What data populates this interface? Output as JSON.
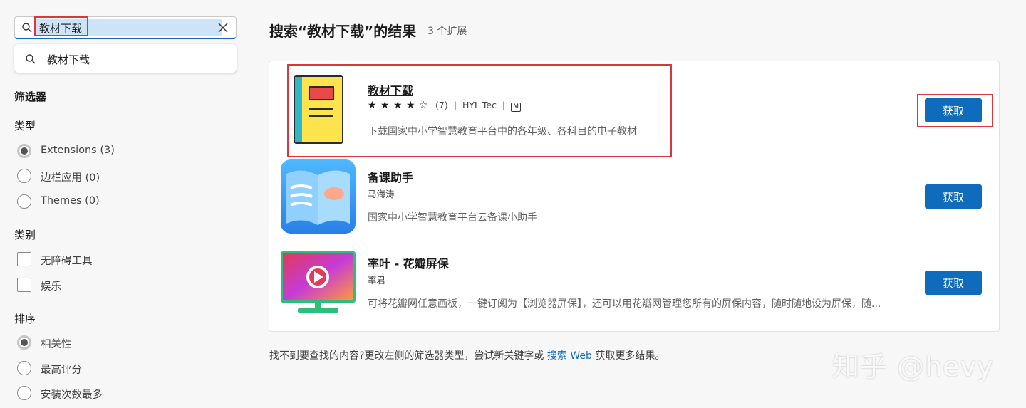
{
  "search": {
    "query": "教材下载",
    "clear_icon": "close-icon"
  },
  "suggestion": {
    "label": "教材下载"
  },
  "filters": {
    "title": "筛选器",
    "type": {
      "title": "类型",
      "options": [
        {
          "label": "Extensions (3)",
          "selected": true
        },
        {
          "label": "边栏应用 (0)",
          "selected": false
        },
        {
          "label": "Themes (0)",
          "selected": false
        }
      ]
    },
    "category": {
      "title": "类别",
      "options": [
        {
          "label": "无障碍工具",
          "checked": false
        },
        {
          "label": "娱乐",
          "checked": false
        }
      ]
    },
    "sort": {
      "title": "排序",
      "options": [
        {
          "label": "相关性",
          "selected": true
        },
        {
          "label": "最高评分",
          "selected": false
        },
        {
          "label": "安装次数最多",
          "selected": false
        }
      ]
    }
  },
  "results": {
    "title": "搜索“教材下载”的结果",
    "count": "3 个扩展",
    "items": [
      {
        "name": "教材下载",
        "stars": "★ ★ ★ ★ ☆",
        "rating": 4,
        "reviews": "(7)",
        "publisher": "HYL Tec",
        "badge": "M",
        "description": "下载国家中小学智慧教育平台中的各年级、各科目的电子教材",
        "button": "获取"
      },
      {
        "name": "备课助手",
        "publisher": "马海涛",
        "description": "国家中小学智慧教育平台云备课小助手",
        "button": "获取"
      },
      {
        "name": "率叶 - 花瓣屏保",
        "publisher": "率君",
        "description": "可将花瓣网任意画板，一键订阅为【浏览器屏保】，还可以用花瓣网管理您所有的屏保内容，随时随地设为屏保，随...",
        "button": "获取"
      }
    ]
  },
  "footer": {
    "text_before": "找不到要查找的内容?更改左侧的筛选器类型，尝试新关键字或",
    "link": "搜索 Web",
    "text_after": "获取更多结果。"
  },
  "watermark": "知乎 @hevy",
  "colors": {
    "accent": "#0f6cbd",
    "highlight": "#d9363e"
  }
}
